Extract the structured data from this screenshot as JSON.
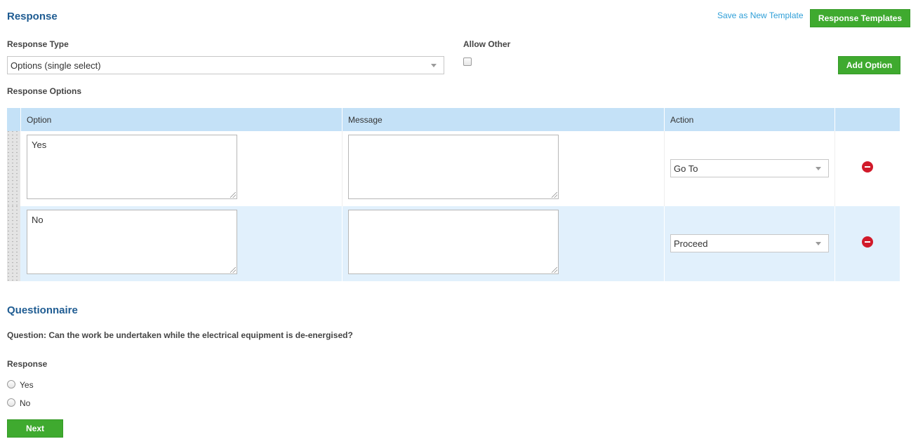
{
  "response_section": {
    "title": "Response",
    "save_template_link": "Save as New Template",
    "templates_button": "Response Templates",
    "response_type_label": "Response Type",
    "response_type_value": "Options (single select)",
    "allow_other_label": "Allow Other",
    "allow_other_checked": false,
    "add_option_button": "Add Option",
    "response_options_label": "Response Options"
  },
  "options_table": {
    "headers": [
      "Option",
      "Message",
      "Action"
    ],
    "rows": [
      {
        "option": "Yes",
        "message": "",
        "action": "Go To"
      },
      {
        "option": "No",
        "message": "",
        "action": "Proceed"
      }
    ]
  },
  "questionnaire": {
    "title": "Questionnaire",
    "question": "Question: Can the work be undertaken while the electrical equipment is de-energised?",
    "response_label": "Response",
    "choices": [
      "Yes",
      "No"
    ],
    "next_button": "Next"
  },
  "icons": {
    "remove": "remove-circle-icon",
    "drag": "drag-handle-icon",
    "dropdown": "caret-down-icon"
  },
  "colors": {
    "accent_green": "#3faa2f",
    "title_blue": "#1f5c92",
    "link_blue": "#2f9fd8",
    "header_bg": "#c4e1f7",
    "alt_row_bg": "#e1f0fc",
    "remove_red": "#d11a2a"
  }
}
